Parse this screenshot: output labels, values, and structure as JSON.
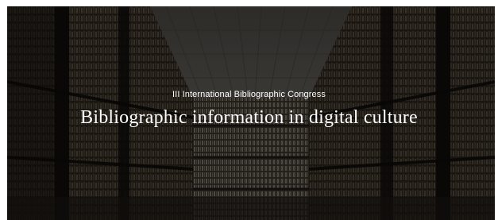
{
  "hero": {
    "subtitle": "III International Bibliographic Congress",
    "title": "Bibliographic information in digital culture"
  },
  "colors": {
    "background_dark": "#1c1a17",
    "shelf_warm": "#3a3127",
    "text": "#ffffff"
  }
}
